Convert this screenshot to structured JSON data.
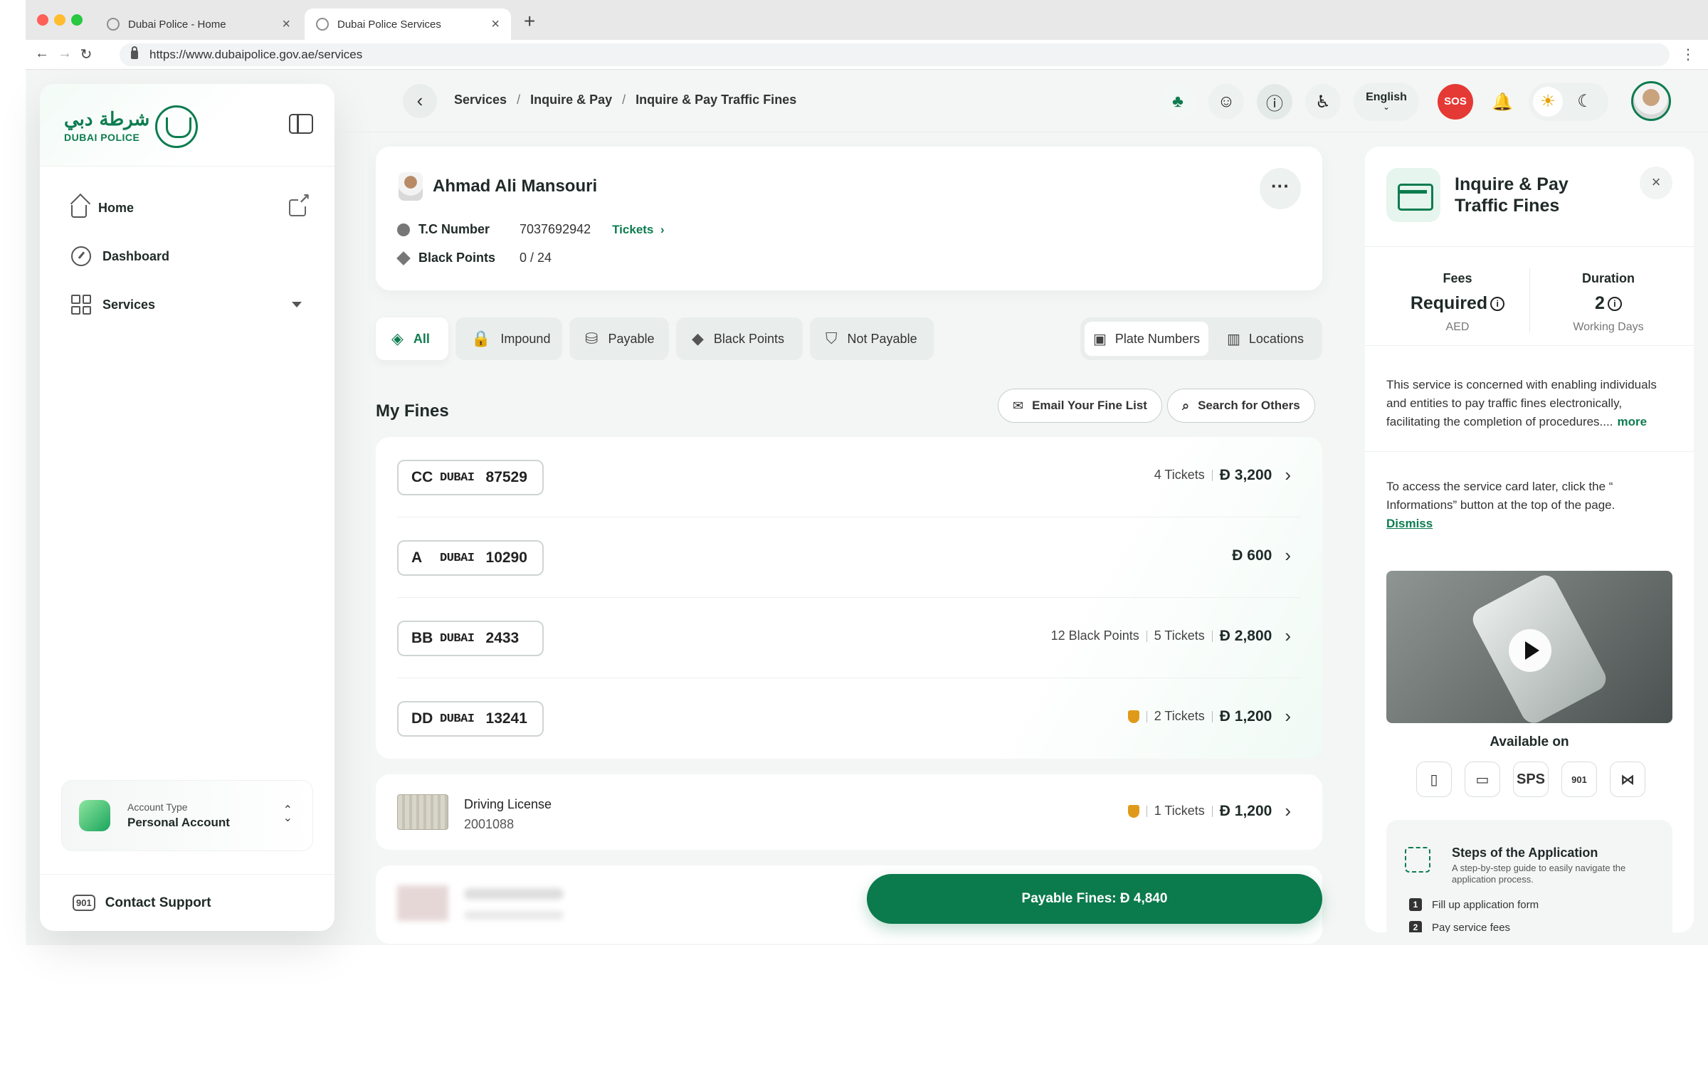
{
  "browser": {
    "tabs": [
      {
        "title": "Dubai Police - Home",
        "active": false
      },
      {
        "title": "Dubai Police Services",
        "active": true
      }
    ],
    "url": "https://www.dubaipolice.gov.ae/services"
  },
  "sidebar": {
    "logo_ar": "شرطة دبي",
    "logo_en": "DUBAI POLICE",
    "items": [
      {
        "label": "Home"
      },
      {
        "label": "Dashboard"
      },
      {
        "label": "Services"
      }
    ],
    "account": {
      "label": "Account Type",
      "value": "Personal Account"
    },
    "support": {
      "icon_text": "901",
      "label": "Contact Support"
    }
  },
  "header": {
    "breadcrumb": [
      "Services",
      "Inquire & Pay",
      "Inquire & Pay Traffic Fines"
    ],
    "language": "English",
    "sos": "SOS"
  },
  "profile": {
    "name": "Ahmad Ali Mansouri",
    "tc_label": "T.C Number",
    "tc_value": "7037692942",
    "tickets_link": "Tickets",
    "bp_label": "Black Points",
    "bp_value": "0 / 24"
  },
  "filters": {
    "items": [
      {
        "label": "All",
        "active": true
      },
      {
        "label": "Impound"
      },
      {
        "label": "Payable"
      },
      {
        "label": "Black Points"
      },
      {
        "label": "Not Payable"
      }
    ],
    "view_toggle": [
      {
        "label": "Plate Numbers",
        "active": true
      },
      {
        "label": "Locations"
      }
    ]
  },
  "fines": {
    "title": "My Fines",
    "email_btn": "Email Your Fine List",
    "search_btn": "Search for Others",
    "currency": "Đ",
    "emirate": "DUBAI",
    "rows": [
      {
        "code": "CC",
        "number": "87529",
        "points": "",
        "tickets": "4 Tickets",
        "amount": "3,200",
        "shield": false
      },
      {
        "code": "A",
        "number": "10290",
        "points": "",
        "tickets": "",
        "amount": "600",
        "shield": false
      },
      {
        "code": "BB",
        "number": "2433",
        "points": "12 Black Points",
        "tickets": "5 Tickets",
        "amount": "2,800",
        "shield": false
      },
      {
        "code": "DD",
        "number": "13241",
        "points": "",
        "tickets": "2 Tickets",
        "amount": "1,200",
        "shield": true
      }
    ],
    "license": {
      "title": "Driving License",
      "number": "2001088",
      "tickets": "1 Tickets",
      "amount": "1,200"
    },
    "pay_button": "Payable Fines: Đ 4,840"
  },
  "panel": {
    "title": "Inquire & Pay Traffic Fines",
    "fees": {
      "label": "Fees",
      "value": "Required",
      "sub": "AED"
    },
    "duration": {
      "label": "Duration",
      "value": "2",
      "sub": "Working Days"
    },
    "description": "This service is concerned with enabling individuals and entities to pay traffic fines electronically, facilitating the completion of procedures....",
    "more": "more",
    "hint": "To access the service card later, click the “ Informations” button at the top of the page.",
    "dismiss": "Dismiss",
    "available_on": "Available on",
    "channels": [
      "mobile",
      "desktop",
      "SPS",
      "901",
      "smart"
    ],
    "channel_sps": "SPS",
    "channel_901": "901",
    "steps_title": "Steps of the Application",
    "steps_sub": "A step-by-step guide to easily navigate the application process.",
    "steps": [
      "Fill up application form",
      "Pay service fees"
    ]
  },
  "colors": {
    "brand_green": "#0d7c4f",
    "pay_button": "#0b7a4c",
    "sos_red": "#e53935",
    "warning_shield": "#e09a1a"
  }
}
